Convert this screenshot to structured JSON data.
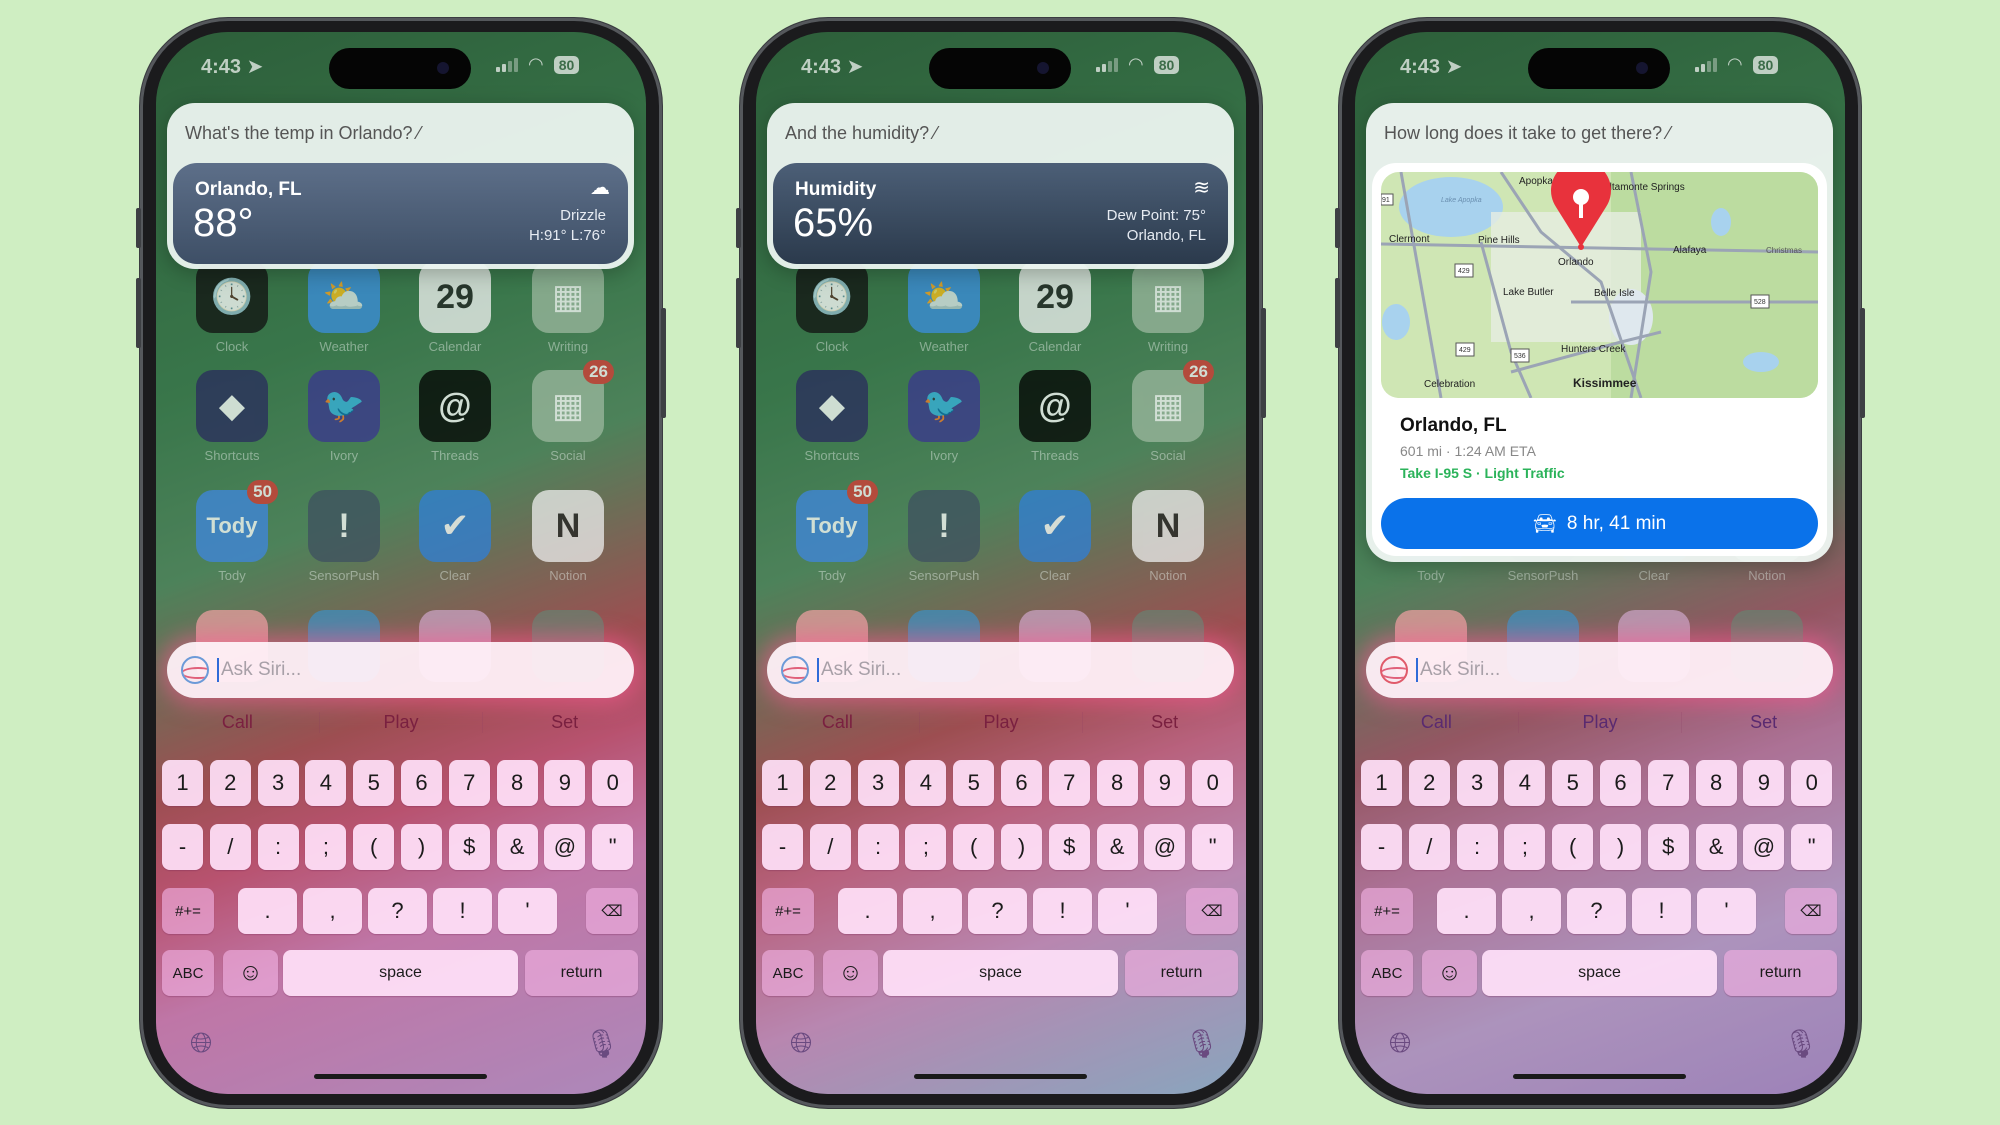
{
  "colors": {
    "background": "#cfeec2",
    "drive_button": "#0a72ea",
    "route_text": "#2bb35a",
    "badge": "#d83a34"
  },
  "status": {
    "time": "4:43",
    "battery": "80"
  },
  "phones": [
    {
      "query": "What's the temp in Orlando?",
      "card": {
        "title": "Orlando, FL",
        "value": "88°",
        "icon": "cloud-drizzle-icon",
        "icon_glyph": "☁",
        "right1": "Drizzle",
        "right2": "H:91° L:76°"
      }
    },
    {
      "query": "And the humidity?",
      "card": {
        "title": "Humidity",
        "value": "65%",
        "icon": "humidity-icon",
        "icon_glyph": "≋",
        "right1": "Dew Point: 75°",
        "right2": "Orlando, FL"
      }
    },
    {
      "query": "How long does it take to get there?",
      "maps": {
        "destination": "Orlando, FL",
        "eta": "601 mi · 1:24 AM ETA",
        "route": "Take I-95 S · Light Traffic",
        "drive_time": "8 hr, 41 min",
        "labels": [
          "Apopka",
          "Altamonte Springs",
          "Lake Apopka",
          "Clermont",
          "Pine Hills",
          "Orlando",
          "Alafaya",
          "Christmas",
          "Lake Butler",
          "Belle Isle",
          "Hunters Creek",
          "Celebration",
          "Kissimmee"
        ],
        "shields": [
          "91",
          "429",
          "429",
          "536",
          "528"
        ]
      }
    }
  ],
  "apps": [
    {
      "label": "Clock",
      "glyph": "🕓",
      "color": "#111111"
    },
    {
      "label": "Weather",
      "glyph": "⛅",
      "color": "#3b8fe0"
    },
    {
      "label": "Calendar",
      "glyph": "29",
      "color": "#f4f4f4"
    },
    {
      "label": "Writing",
      "glyph": "▦",
      "color": "#9cb89f"
    },
    {
      "label": "Shortcuts",
      "glyph": "◆",
      "color": "#2a2b5e"
    },
    {
      "label": "Ivory",
      "glyph": "🐦",
      "color": "#3a3690"
    },
    {
      "label": "Threads",
      "glyph": "@",
      "color": "#000000"
    },
    {
      "label": "Social",
      "glyph": "▦",
      "color": "#9cb89f",
      "badge": "26"
    },
    {
      "label": "Tody",
      "glyph": "Tody",
      "color": "#3f86e0",
      "badge": "50"
    },
    {
      "label": "SensorPush",
      "glyph": "!",
      "color": "#3e5060"
    },
    {
      "label": "Clear",
      "glyph": "✔",
      "color": "#2f7fd8"
    },
    {
      "label": "Notion",
      "glyph": "N",
      "color": "#eeeeee"
    }
  ],
  "siri": {
    "placeholder": "Ask Siri...",
    "suggestions": [
      "Call",
      "Play",
      "Set"
    ]
  },
  "keyboard": {
    "row1": [
      "1",
      "2",
      "3",
      "4",
      "5",
      "6",
      "7",
      "8",
      "9",
      "0"
    ],
    "row2": [
      "-",
      "/",
      ":",
      ";",
      "(",
      ")",
      "$",
      "&",
      "@",
      "\""
    ],
    "row3": [
      ".",
      ",",
      "?",
      "!",
      "'"
    ],
    "symbols": "#+=",
    "abc": "ABC",
    "space": "space",
    "return": "return"
  }
}
